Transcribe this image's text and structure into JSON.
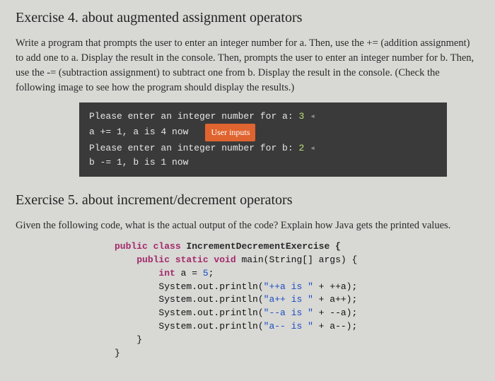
{
  "ex4": {
    "heading": "Exercise 4. about augmented assignment operators",
    "body": "Write a program that prompts the user to enter an integer number for a. Then, use the += (addition assignment) to add one to a. Display the result in the console. Then, prompts the user to enter an integer number for b. Then, use the -= (subtraction assignment) to subtract one from b. Display the result in the console. (Check the following image to see how the program should display the results.)",
    "console": {
      "prompt_a": "Please enter an integer number for a: ",
      "input_a": "3",
      "result_a": "a += 1, a is 4 now",
      "prompt_b": "Please enter an integer number for b: ",
      "input_b": "2",
      "result_b": "b -= 1, b is 1 now",
      "badge": "User inputs"
    }
  },
  "ex5": {
    "heading": "Exercise 5. about increment/decrement operators",
    "body": "Given the following code, what is the actual output of the code? Explain how Java gets the printed values.",
    "code": {
      "l1a": "public class",
      "l1b": " IncrementDecrementExercise {",
      "l2a": "public static void",
      "l2b": " main(String[] args) {",
      "l3a": "int",
      "l3b": " a = ",
      "l3c": "5",
      "l3d": ";",
      "l4a": "System.out.println(",
      "l4s": "\"++a is \"",
      "l4b": " + ++a);",
      "l5a": "System.out.println(",
      "l5s": "\"a++ is \"",
      "l5b": " + a++);",
      "l6a": "System.out.println(",
      "l6s": "\"--a is \"",
      "l6b": " + --a);",
      "l7a": "System.out.println(",
      "l7s": "\"a-- is \"",
      "l7b": " + a--);",
      "l8": "}",
      "l9": "}"
    }
  }
}
